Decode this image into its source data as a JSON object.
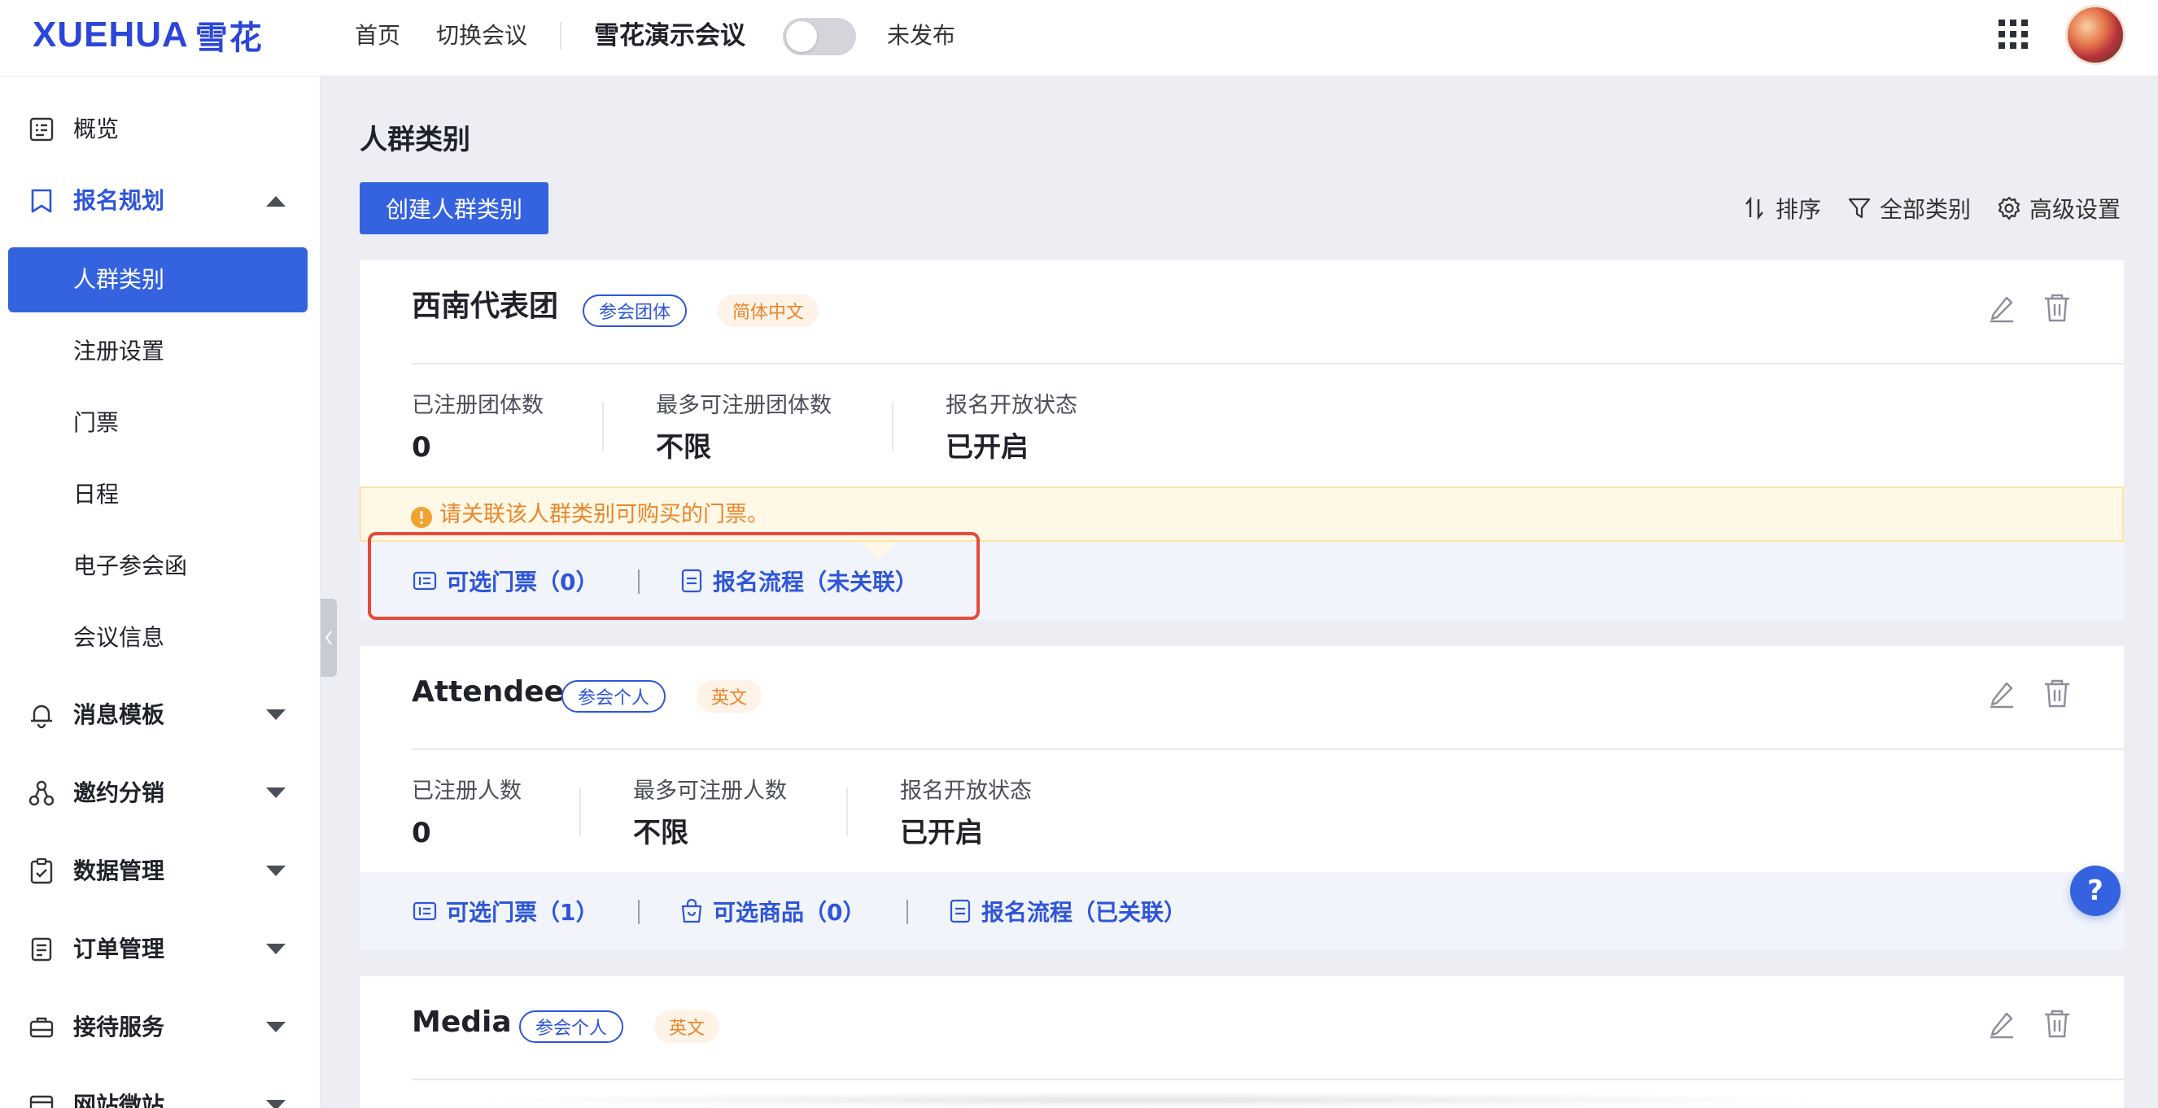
{
  "header": {
    "logo_text": "XUEHUA",
    "logo_cn": "雪花",
    "nav": [
      "首页",
      "切换会议"
    ],
    "meeting_title": "雪花演示会议",
    "publish_toggle_on": false,
    "publish_status": "未发布",
    "apps_icon": "grid-apps-icon",
    "avatar_icon": "user-avatar"
  },
  "sidebar": {
    "items": [
      {
        "label": "概览",
        "icon": "overview-icon"
      },
      {
        "label": "报名规划",
        "icon": "bookmark-icon",
        "expanded": true
      },
      {
        "label": "消息模板",
        "icon": "bell-icon"
      },
      {
        "label": "邀约分销",
        "icon": "share-network-icon"
      },
      {
        "label": "数据管理",
        "icon": "clipboard-check-icon"
      },
      {
        "label": "订单管理",
        "icon": "order-list-icon"
      },
      {
        "label": "接待服务",
        "icon": "luggage-icon"
      },
      {
        "label": "网站微站",
        "icon": "website-icon"
      }
    ],
    "sub_items": [
      "人群类别",
      "注册设置",
      "门票",
      "日程",
      "电子参会函",
      "会议信息"
    ],
    "active_sub": "人群类别"
  },
  "main": {
    "title": "人群类别",
    "create_button": "创建人群类别",
    "toolbar": {
      "sort": "排序",
      "filter": "全部类别",
      "advanced": "高级设置"
    },
    "cards": [
      {
        "name": "西南代表团",
        "type_tag": "参会团体",
        "lang_tag": "简体中文",
        "stats": [
          {
            "label": "已注册团体数",
            "value": "0"
          },
          {
            "label": "最多可注册团体数",
            "value": "不限"
          },
          {
            "label": "报名开放状态",
            "value": "已开启"
          }
        ],
        "warning": "请关联该人群类别可购买的门票。",
        "links": [
          "可选门票（0）",
          "报名流程（未关联）"
        ]
      },
      {
        "name": "Attendee",
        "type_tag": "参会个人",
        "lang_tag": "英文",
        "stats": [
          {
            "label": "已注册人数",
            "value": "0"
          },
          {
            "label": "最多可注册人数",
            "value": "不限"
          },
          {
            "label": "报名开放状态",
            "value": "已开启"
          }
        ],
        "links": [
          "可选门票（1）",
          "可选商品（0）",
          "报名流程（已关联）"
        ]
      },
      {
        "name": "Media",
        "type_tag": "参会个人",
        "lang_tag": "英文"
      }
    ]
  },
  "help_label": "?",
  "colors": {
    "primary": "#3563e0",
    "link": "#2e55d9",
    "warning": "#e8862c",
    "warning_bg": "#fff8e6",
    "highlight": "#e64a3c"
  }
}
